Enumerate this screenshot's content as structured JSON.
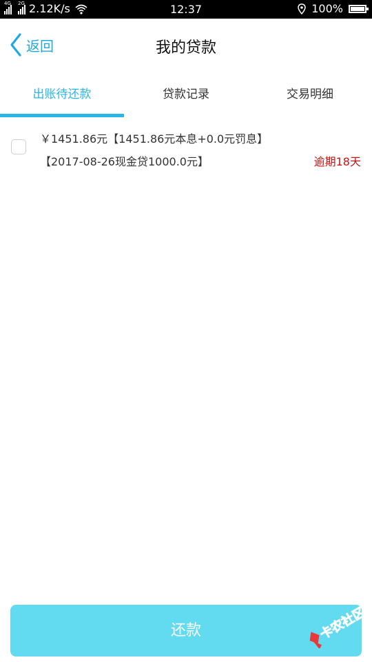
{
  "status_bar": {
    "signal1_tag": "4G",
    "signal2_tag": "2G",
    "speed": "2.12K/s",
    "time": "12:37",
    "battery": "100%",
    "icons": [
      "wifi-icon",
      "location-icon",
      "battery-icon"
    ]
  },
  "header": {
    "back_label": "返回",
    "title": "我的贷款",
    "accent_color": "#23a7e0"
  },
  "tabs": [
    {
      "label": "出账待还款",
      "active": true
    },
    {
      "label": "贷款记录",
      "active": false
    },
    {
      "label": "交易明细",
      "active": false
    }
  ],
  "loan_items": [
    {
      "checked": false,
      "amount_line": "￥1451.86元【1451.86元本息+0.0元罚息】",
      "detail_line": "【2017-08-26现金贷1000.0元】",
      "overdue": "逾期18天",
      "overdue_color": "#cc1111"
    }
  ],
  "footer": {
    "repay_label": "还款",
    "button_color": "#62dbf0"
  },
  "watermark": {
    "text": "卡农社区"
  }
}
